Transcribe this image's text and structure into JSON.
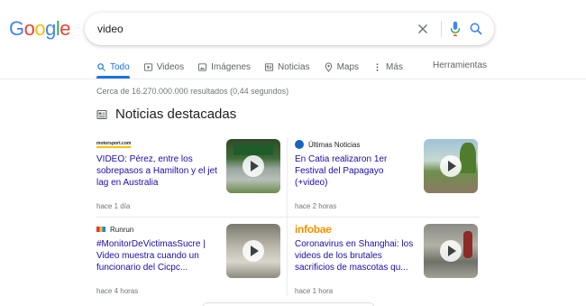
{
  "header": {
    "logo_letters": [
      {
        "char": "G",
        "color": "#4285f4"
      },
      {
        "char": "o",
        "color": "#ea4335"
      },
      {
        "char": "o",
        "color": "#fbbc05"
      },
      {
        "char": "g",
        "color": "#4285f4"
      },
      {
        "char": "l",
        "color": "#34a853"
      },
      {
        "char": "e",
        "color": "#ea4335"
      }
    ],
    "search_query": "video",
    "icons": [
      "close-icon",
      "microphone-icon",
      "search-icon"
    ]
  },
  "tabs": [
    {
      "label": "Todo",
      "icon": "search-icon",
      "active": true
    },
    {
      "label": "Videos",
      "icon": "play-icon",
      "active": false
    },
    {
      "label": "Imágenes",
      "icon": "image-icon",
      "active": false
    },
    {
      "label": "Noticias",
      "icon": "news-icon",
      "active": false
    },
    {
      "label": "Maps",
      "icon": "map-pin-icon",
      "active": false
    },
    {
      "label": "Más",
      "icon": "more-icon",
      "active": false
    }
  ],
  "tools_label": "Herramientas",
  "result_stats": "Cerca de 16.270.000.000 resultados (0,44 segundos)",
  "news": {
    "heading": "Noticias destacadas",
    "cards": [
      {
        "source": "motorsport.com",
        "title": "VIDEO: Pérez, entre los sobrepasos a Hamilton y el jet lag en Australia",
        "time": "hace 1 día"
      },
      {
        "source": "Últimas Noticias",
        "title": "En Catia realizaron 1er Festival del Papagayo (+video)",
        "time": "hace 2 horas"
      },
      {
        "source": "Runrun",
        "title": "#MonitorDeVictimasSucre | Video muestra cuando un funcionario del Cicpc...",
        "time": "hace 4 horas"
      },
      {
        "source": "infobae",
        "title": "Coronavirus en Shanghai: los videos de los brutales sacrificios de mascotas qu...",
        "time": "hace 1 hora"
      }
    ]
  },
  "colors": {
    "link": "#1a0dab",
    "accent": "#1a73e8",
    "muted": "#70757a",
    "infobae": "#f39200"
  }
}
